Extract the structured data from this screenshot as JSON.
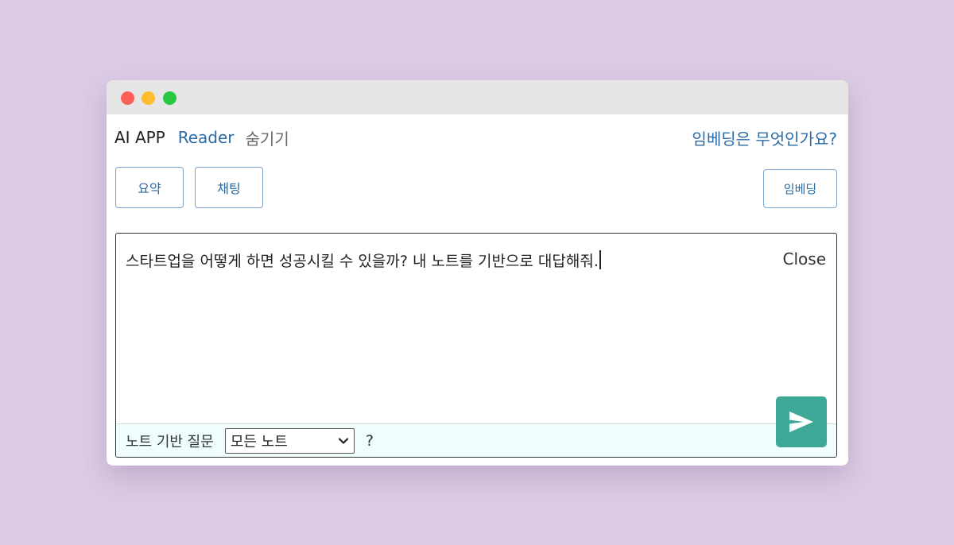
{
  "window": {
    "controls": [
      "close",
      "minimize",
      "maximize"
    ]
  },
  "navbar": {
    "brand": "AI APP",
    "reader_link": "Reader",
    "hide_link": "숨기기",
    "embedding_question": "임베딩은 무엇인가요?"
  },
  "toolbar": {
    "summary_label": "요약",
    "chat_label": "채팅",
    "embedding_label": "임베딩"
  },
  "chat": {
    "input_value": "스타트업을 어떻게 하면 성공시킬 수 있을까? 내 노트를 기반으로 대답해줘.",
    "close_label": "Close",
    "footer_label": "노트 기반 질문",
    "note_select_value": "모든 노트",
    "help_label": "?",
    "send_icon": "paper-plane-icon"
  },
  "colors": {
    "background": "#dccbe4",
    "link": "#2c6aa6",
    "send_button": "#3ea896",
    "footer_bg": "#effdfd"
  }
}
